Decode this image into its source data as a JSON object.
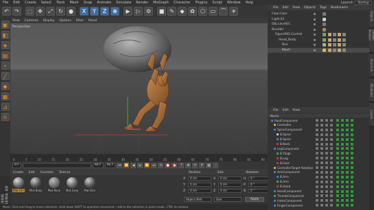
{
  "menu": {
    "items": [
      "File",
      "Edit",
      "Create",
      "Select",
      "Tools",
      "Mesh",
      "Snap",
      "Animate",
      "Simulate",
      "Render",
      "MoGraph",
      "Character",
      "Plugins",
      "Script",
      "Window",
      "Help"
    ],
    "layout_label": "Layout:",
    "layout_value": "Startup"
  },
  "toolbar": {
    "icons": [
      "undo-icon",
      "redo-icon",
      "select-icon",
      "move-icon",
      "scale-icon",
      "rotate-icon",
      "last-tool-icon",
      "x-axis-icon",
      "y-axis-icon",
      "z-axis-icon",
      "world-icon",
      "render-view-icon",
      "render-icon",
      "render-settings-icon",
      "cube-icon",
      "pen-icon",
      "subdivision-icon",
      "array-icon",
      "deformer-icon",
      "floor-icon",
      "camera-icon",
      "light-icon"
    ],
    "glyphs": [
      "↶",
      "↷",
      "⬚",
      "✥",
      "⤢",
      "↻",
      "●",
      "X",
      "Y",
      "Z",
      "⊕",
      "▶",
      "▷",
      "⚙",
      "■",
      "✎",
      "◆",
      "✿",
      "⬡",
      "▭",
      "⌒",
      "☀"
    ]
  },
  "left_tools": {
    "icons": [
      "make-editable-icon",
      "model-mode-icon",
      "texture-mode-icon",
      "workplane-icon",
      "points-icon",
      "edges-icon",
      "polygons-icon",
      "uv-icon",
      "snap-icon",
      "magnet-icon"
    ],
    "glyphs": [
      "▣",
      "◧",
      "◈",
      "▤",
      "∙",
      "╱",
      "◆",
      "▦",
      "⊿",
      "∩"
    ]
  },
  "viewport": {
    "menu": [
      "View",
      "Cameras",
      "Display",
      "Options",
      "Filter",
      "Panel"
    ],
    "label": "Perspective"
  },
  "timeline": {
    "ticks": [
      "0",
      "5",
      "10",
      "15",
      "20",
      "25",
      "30",
      "35",
      "40",
      "45",
      "50",
      "55",
      "60",
      "65",
      "70",
      "75",
      "80",
      "85",
      "90"
    ],
    "end_label": "0 F"
  },
  "playbar": {
    "start_frame": "0 F",
    "current_frame": "0 F",
    "end_frame": "90 F",
    "max_frame": "90 F",
    "buttons": [
      "⏮",
      "⏪",
      "◀",
      "▶",
      "⏩",
      "⏭",
      "⟲",
      "●",
      "◉",
      "?",
      "✥",
      "⟳",
      "P",
      "▦",
      "⋮"
    ]
  },
  "materials": {
    "menu": [
      "Create",
      "Edit",
      "Function",
      "Texture"
    ],
    "swatches": [
      "Mat.Ctrl",
      "Mat.Body",
      "Mat.Rock",
      "Mat.Grey",
      "Mat.Skin"
    ]
  },
  "coordinates": {
    "headers": [
      "Position",
      "Size",
      "Rotation"
    ],
    "rows": [
      {
        "axis": "X",
        "pos": "0 cm",
        "size": "0 cm",
        "rot_axis": "H",
        "rot": "0 °"
      },
      {
        "axis": "Y",
        "pos": "0 cm",
        "size": "0 cm",
        "rot_axis": "P",
        "rot": "0 °"
      },
      {
        "axis": "Z",
        "pos": "0 cm",
        "size": "0 cm",
        "rot_axis": "B",
        "rot": "0 °"
      }
    ],
    "mode": "Object (Rel)",
    "size_mode": "Size",
    "apply_label": "Apply"
  },
  "status": {
    "text": "Move: Click and drag to move elements. Hold down SHIFT to quantize movement / add to the selection in point mode, CTRL to remove."
  },
  "maxon_logo": "MAXON CINEMA 4D",
  "objects": {
    "menu": [
      "File",
      "Edit",
      "View",
      "Objects",
      "Tags",
      "Bookmarks"
    ],
    "rows": [
      {
        "name": "Floor.Cam",
        "indent": 0,
        "tag": "#7a7a7a"
      },
      {
        "name": "Light.01",
        "indent": 0,
        "tag": "#c9c9c9"
      },
      {
        "name": "Obj.Level01",
        "indent": 0,
        "tag": "#7a7a7a"
      },
      {
        "name": "Boulder",
        "indent": 0,
        "tag": "#a38a5e"
      },
      {
        "name": "FigureRIG.Control",
        "indent": 1,
        "tag": "#7fa652"
      },
      {
        "name": "Head_Body",
        "indent": 2,
        "tag": "#7fa652"
      },
      {
        "name": "Bus",
        "indent": 3,
        "tag": "#aaaaaa"
      },
      {
        "name": "Mesh",
        "indent": 3,
        "tag": "#e0b441"
      }
    ]
  },
  "attributes": {
    "menu": [
      "File",
      "Edit",
      "View"
    ],
    "header": "Name",
    "rows": [
      {
        "name": "RootComponent",
        "color": "#3a7fd1",
        "indent": 0
      },
      {
        "name": "Controller",
        "color": "#d8a43a",
        "indent": 1
      },
      {
        "name": "SpineComponent",
        "color": "#3a7fd1",
        "indent": 1
      },
      {
        "name": "B.Spine",
        "color": "#c0c0c0",
        "indent": 2
      },
      {
        "name": "B.Spine",
        "color": "#3a7fd1",
        "indent": 2
      },
      {
        "name": "B.Neck",
        "color": "#c8372e",
        "indent": 2
      },
      {
        "name": "LegComponent",
        "color": "#3a7fd1",
        "indent": 1
      },
      {
        "name": "B.Thigh",
        "color": "#39a64f",
        "indent": 2
      },
      {
        "name": "B.Leg",
        "color": "#c8372e",
        "indent": 2
      },
      {
        "name": "B.Foot",
        "color": "#c8372e",
        "indent": 2
      },
      {
        "name": "ControllerTarget Rotation",
        "color": "#d8a43a",
        "indent": 1
      },
      {
        "name": "ArmComponent",
        "color": "#3a7fd1",
        "indent": 1
      },
      {
        "name": "B.Arm",
        "color": "#3a7fd1",
        "indent": 2
      },
      {
        "name": "B.Arm",
        "color": "#39a64f",
        "indent": 2
      },
      {
        "name": "B.Hand",
        "color": "#c8372e",
        "indent": 2
      },
      {
        "name": "HandComponent",
        "color": "#3a7fd1",
        "indent": 1
      },
      {
        "name": "ThumbComponent",
        "color": "#39a64f",
        "indent": 1
      },
      {
        "name": "IndexComponent",
        "color": "#3a7fd1",
        "indent": 1
      },
      {
        "name": "FingerComponent",
        "color": "#3a7fd1",
        "indent": 1
      }
    ]
  },
  "right_tabs": [
    "Objects",
    "Content Browser",
    "Structure",
    "Attributes",
    "Layers"
  ]
}
